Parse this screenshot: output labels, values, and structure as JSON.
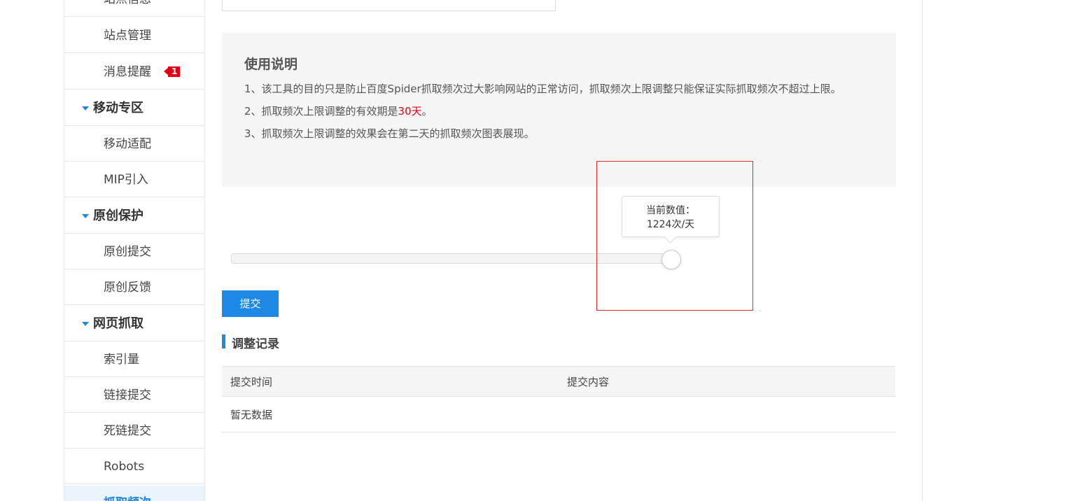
{
  "sidebar": {
    "items": [
      {
        "label": "站点信息",
        "type": "item"
      },
      {
        "label": "站点管理",
        "type": "item"
      },
      {
        "label": "消息提醒",
        "type": "item",
        "badge": "1"
      },
      {
        "label": "移动专区",
        "type": "group"
      },
      {
        "label": "移动适配",
        "type": "item"
      },
      {
        "label": "MIP引入",
        "type": "item"
      },
      {
        "label": "原创保护",
        "type": "group"
      },
      {
        "label": "原创提交",
        "type": "item"
      },
      {
        "label": "原创反馈",
        "type": "item"
      },
      {
        "label": "网页抓取",
        "type": "group"
      },
      {
        "label": "索引量",
        "type": "item"
      },
      {
        "label": "链接提交",
        "type": "item"
      },
      {
        "label": "死链提交",
        "type": "item"
      },
      {
        "label": "Robots",
        "type": "item"
      },
      {
        "label": "抓取频次",
        "type": "item",
        "active": true
      }
    ]
  },
  "notice": {
    "title": "使用说明",
    "line1": "1、该工具的目的只是防止百度Spider抓取频次过大影响网站的正常访问，抓取频次上限调整只能保证实际抓取频次不超过上限。",
    "line2_prefix": "2、抓取频次上限调整的有效期是",
    "line2_highlight": "30天",
    "line2_suffix": "。",
    "line3": "3、抓取频次上限调整的效果会在第二天的抓取频次图表展现。"
  },
  "slider": {
    "tooltip_label": "当前数值：",
    "tooltip_value": "1224次/天",
    "position_fraction": 0.97
  },
  "submit_label": "提交",
  "records": {
    "title": "调整记录",
    "columns": [
      "提交时间",
      "提交内容"
    ],
    "empty_text": "暂无数据"
  },
  "colors": {
    "accent": "#1e88e5",
    "badge": "#e60012",
    "highlight_box": "#e0292c"
  }
}
